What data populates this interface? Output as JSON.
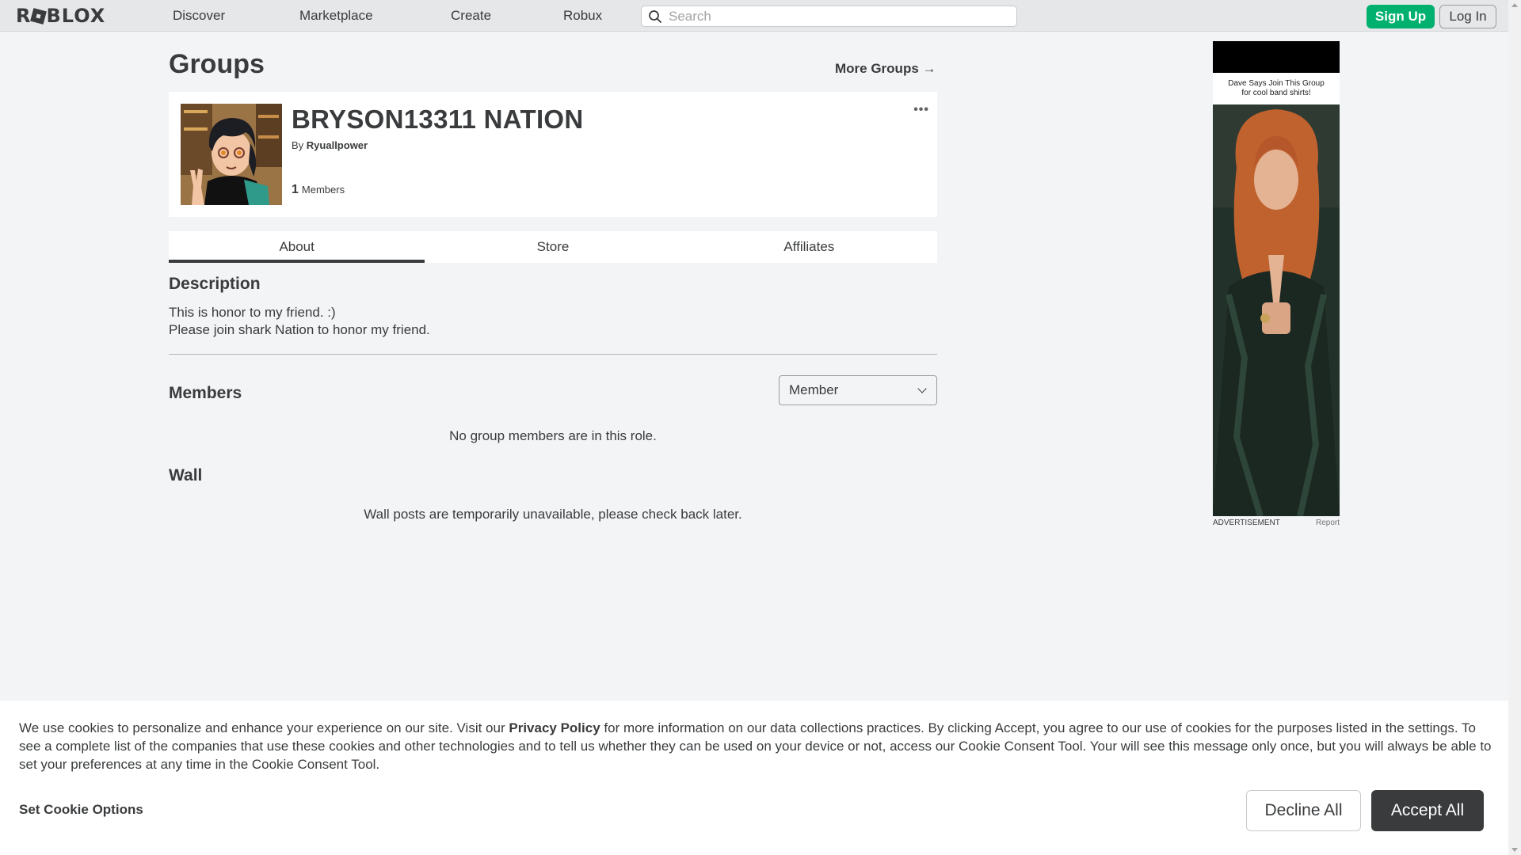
{
  "nav": {
    "logo": "ROBLOX",
    "links": [
      "Discover",
      "Marketplace",
      "Create",
      "Robux"
    ],
    "search_placeholder": "Search",
    "signup_label": "Sign Up",
    "login_label": "Log In"
  },
  "page": {
    "title": "Groups",
    "more_groups": "More Groups →"
  },
  "group": {
    "name": "BRYSON13311 NATION",
    "by_prefix": "By",
    "owner": "Ryuallpower",
    "member_count": "1",
    "members_label": "Members",
    "more_icon": "•••"
  },
  "tabs": [
    "About",
    "Store",
    "Affiliates"
  ],
  "about": {
    "description_title": "Description",
    "description_lines": [
      "This is honor to my friend. :)",
      "Please join shark Nation to honor my friend."
    ],
    "members_title": "Members",
    "role_selected": "Member",
    "members_empty": "No group members are in this role.",
    "wall_title": "Wall",
    "wall_empty": "Wall posts are temporarily unavailable, please check back later."
  },
  "ad": {
    "caption_line1": "Dave Says Join This Group",
    "caption_line2": "for cool band shirts!",
    "label": "ADVERTISEMENT",
    "report": "Report"
  },
  "cookie": {
    "text_before": "We use cookies to personalize and enhance your experience on our site. Visit our ",
    "privacy_link": "Privacy Policy",
    "text_after": " for more information on our data collections practices. By clicking Accept, you agree to our use of cookies for the purposes listed in the settings. To see a complete list of the companies that use these cookies and other technologies and to tell us whether they can be used on your device or not, access our Cookie Consent Tool. Your will see this message only once, but you will always be able to set your preferences at any time in the Cookie Consent Tool.",
    "options_label": "Set Cookie Options",
    "decline_label": "Decline All",
    "accept_label": "Accept All"
  },
  "colors": {
    "signup_green": "#00b06f",
    "text_dark": "#393b3d",
    "background": "#f2f4f5"
  }
}
